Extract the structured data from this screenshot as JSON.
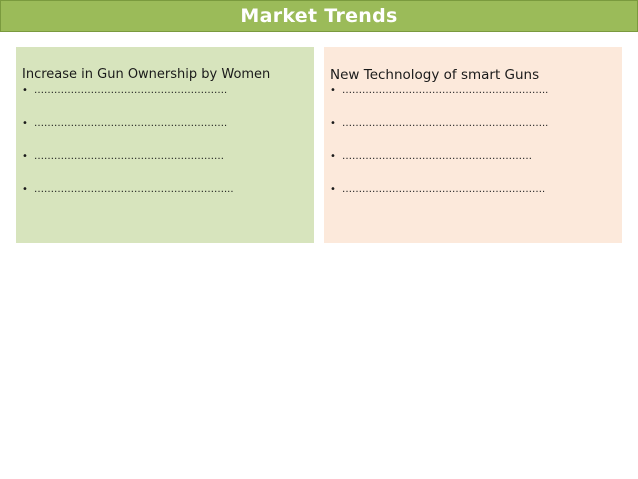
{
  "title": "Market Trends",
  "colors": {
    "title_bar": "#9bbb59",
    "left_panel": "#d7e4bd",
    "right_panel": "#fce9db"
  },
  "panels": [
    {
      "heading": "Increase in Gun Ownership by Women",
      "bullets": [
        "………………………………………………….",
        "………………………………………………….",
        "…………………………………………………",
        "…………………………………………………..."
      ]
    },
    {
      "heading": "New Technology of smart Guns",
      "bullets": [
        "……………………………………………………..",
        "……………………………………………………..",
        "…………………………………………………",
        "……………………………………………………."
      ]
    }
  ],
  "bullet_glyph": "•"
}
